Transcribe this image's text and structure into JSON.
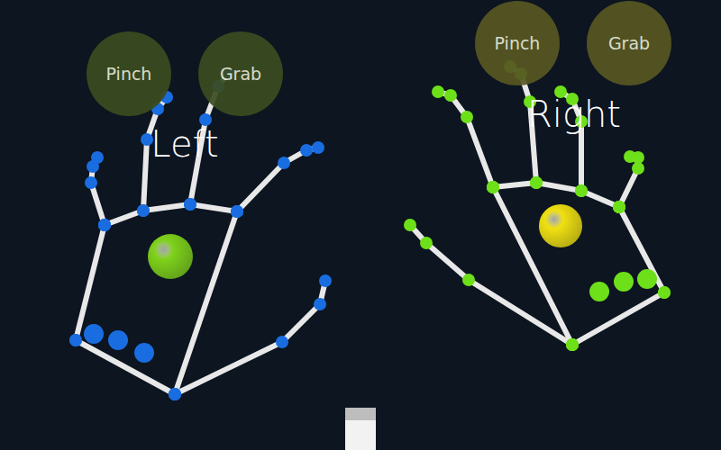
{
  "hands": [
    {
      "label": "Left",
      "color": "#1a6de0",
      "palm_color": "#7fd21a",
      "indicators": [
        {
          "label": "Pinch",
          "level": 0.3
        },
        {
          "label": "Grab",
          "level": 0.3
        }
      ]
    },
    {
      "label": "Right",
      "color": "#6ee01a",
      "palm_color": "#f0e010",
      "indicators": [
        {
          "label": "Pinch",
          "level": 0.55
        },
        {
          "label": "Grab",
          "level": 0.55
        }
      ]
    }
  ]
}
